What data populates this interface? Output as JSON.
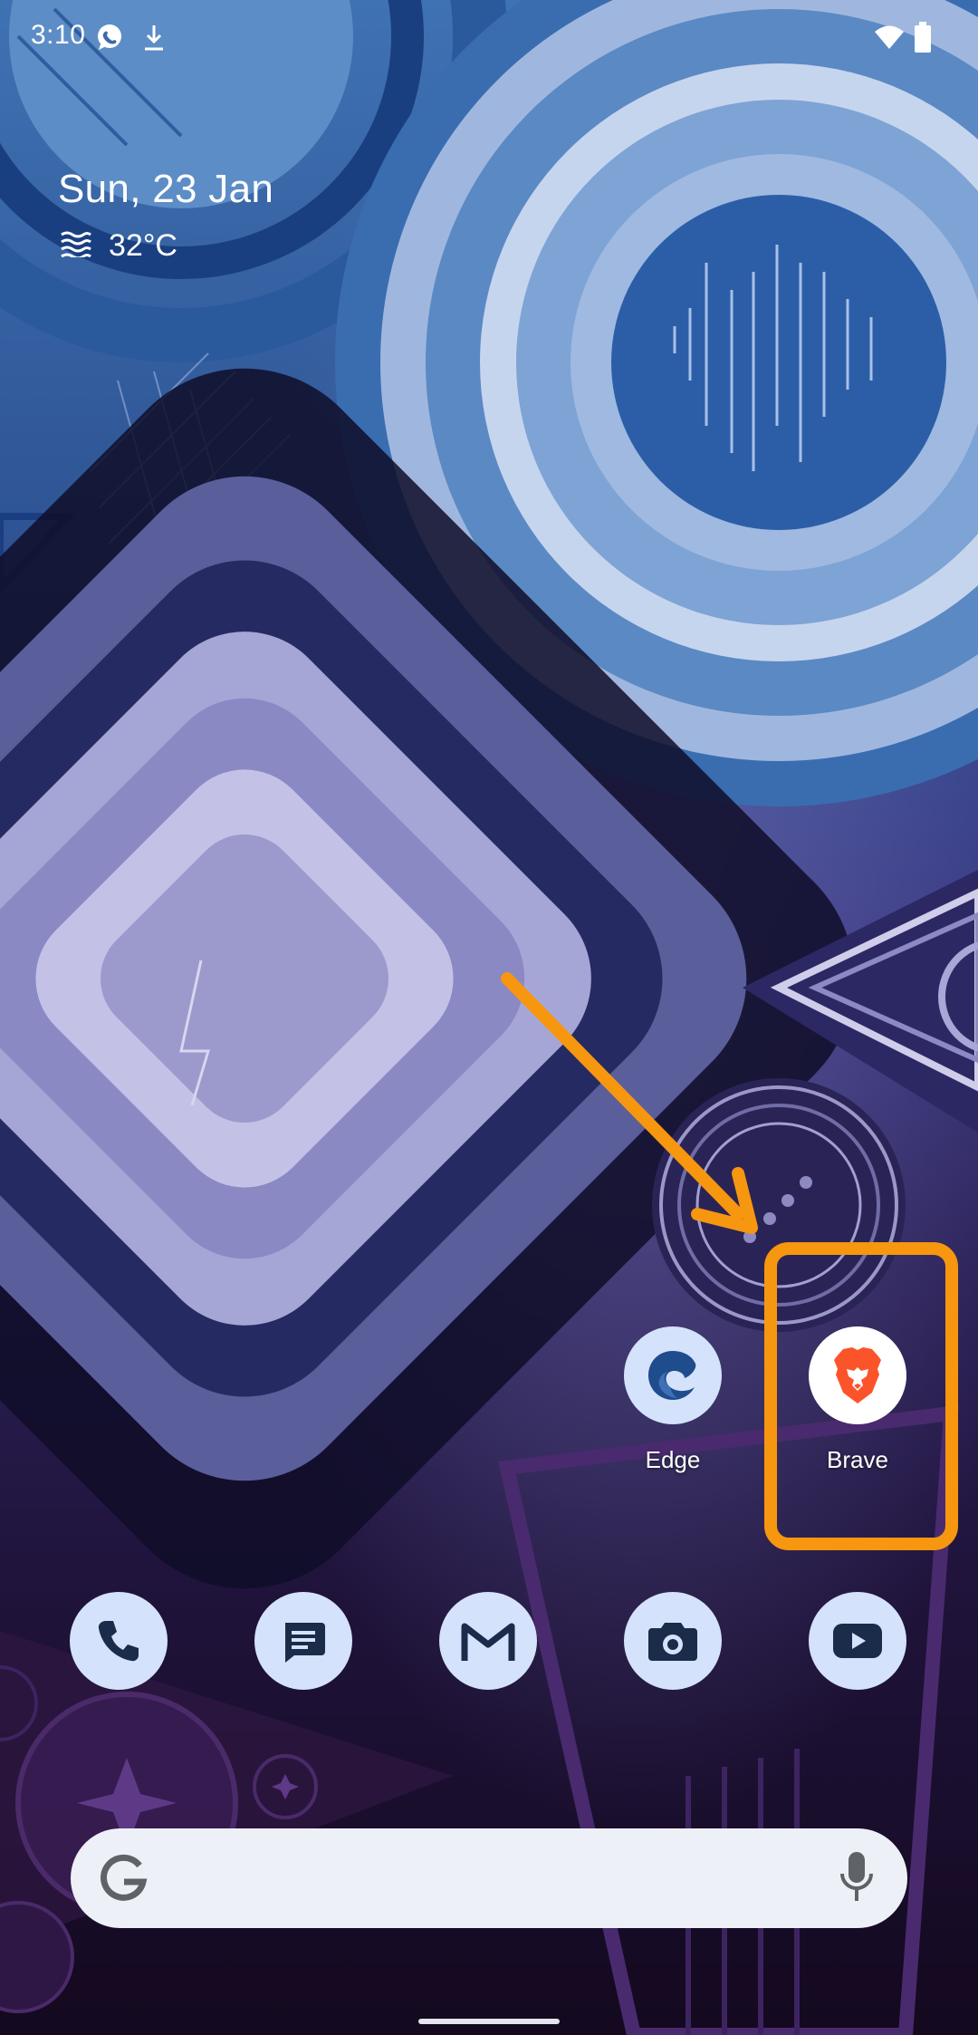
{
  "status_bar": {
    "time": "3:10",
    "icons": [
      "whatsapp-icon",
      "download-icon",
      "wifi-icon",
      "battery-icon"
    ]
  },
  "date_widget": {
    "date": "Sun, 23 Jan",
    "weather_icon": "haze-icon",
    "temperature": "32°C"
  },
  "apps": [
    {
      "label": "Edge",
      "icon": "edge-icon"
    },
    {
      "label": "Brave",
      "icon": "brave-icon"
    }
  ],
  "dock": [
    "phone-icon",
    "messages-icon",
    "gmail-icon",
    "camera-icon",
    "youtube-icon"
  ],
  "search_bar": {
    "logo": "google-g-icon",
    "voice": "mic-icon"
  },
  "colors": {
    "annotation": "#f7960f",
    "icon_bg": "#d4e2fb",
    "brave": "#fb542b"
  }
}
